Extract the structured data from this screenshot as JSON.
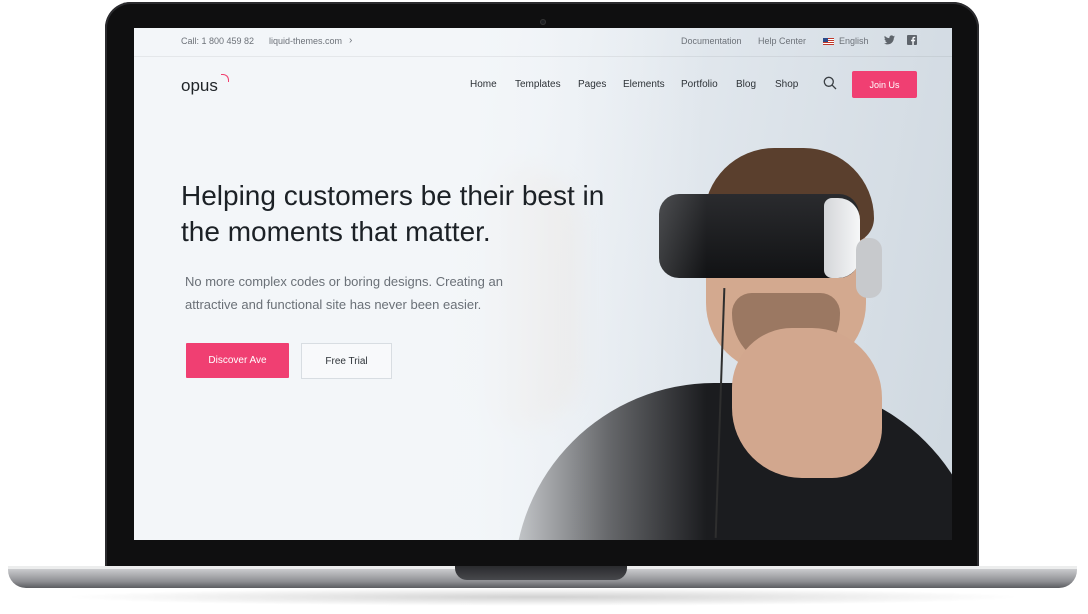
{
  "topbar": {
    "phone": "Call: 1 800 459 82",
    "site": "liquid-themes.com",
    "site_chevron": "›",
    "documentation": "Documentation",
    "help_center": "Help Center",
    "language": "English",
    "twitter_icon": "twitter-icon",
    "facebook_icon": "facebook-icon"
  },
  "header": {
    "logo": "opus",
    "nav": [
      "Home",
      "Templates",
      "Pages",
      "Elements",
      "Portfolio",
      "Blog",
      "Shop"
    ],
    "join_label": "Join Us"
  },
  "hero": {
    "title_line1": "Helping customers be their best in",
    "title_line2": "the moments that matter.",
    "subtitle_line1": "No more complex codes or boring designs. Creating an",
    "subtitle_line2": "attractive and functional site has never been easier.",
    "primary_button": "Discover Ave",
    "secondary_button": "Free Trial"
  },
  "colors": {
    "accent": "#f03f72",
    "text_dark": "#1c2126",
    "text_muted": "#6a7077"
  }
}
